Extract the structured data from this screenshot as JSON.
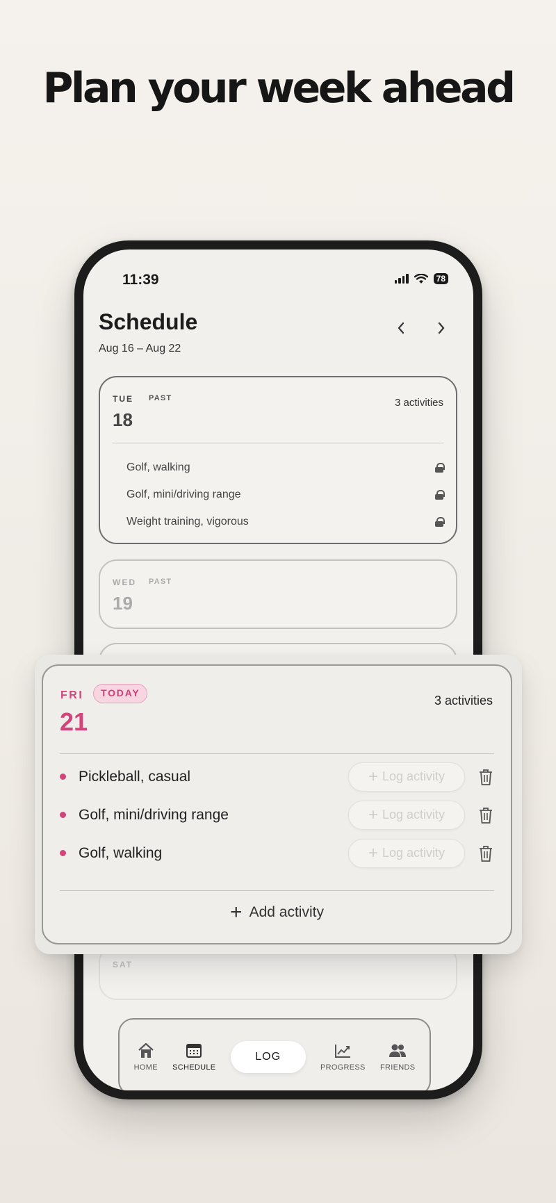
{
  "headline": "Plan your week ahead",
  "status": {
    "time": "11:39",
    "battery": "78"
  },
  "header": {
    "title": "Schedule",
    "range": "Aug 16 – Aug 22",
    "prev_icon": "chevron-left-icon",
    "next_icon": "chevron-right-icon"
  },
  "days": {
    "tue": {
      "dow": "TUE",
      "tag": "PAST",
      "num": "18",
      "count": "3 activities",
      "items": [
        "Golf, walking",
        "Golf, mini/driving range",
        "Weight training, vigorous"
      ]
    },
    "wed": {
      "dow": "WED",
      "tag": "PAST",
      "num": "19"
    },
    "sat": {
      "dow": "SAT"
    }
  },
  "today_card": {
    "dow": "FRI",
    "badge": "TODAY",
    "num": "21",
    "count": "3 activities",
    "items": [
      "Pickleball, casual",
      "Golf, mini/driving range",
      "Golf, walking"
    ],
    "log_label": "Log activity",
    "add_label": "Add activity",
    "accent": "#d1457b"
  },
  "tabbar": {
    "home": "HOME",
    "schedule": "SCHEDULE",
    "log": "LOG",
    "progress": "PROGRESS",
    "friends": "FRIENDS"
  }
}
